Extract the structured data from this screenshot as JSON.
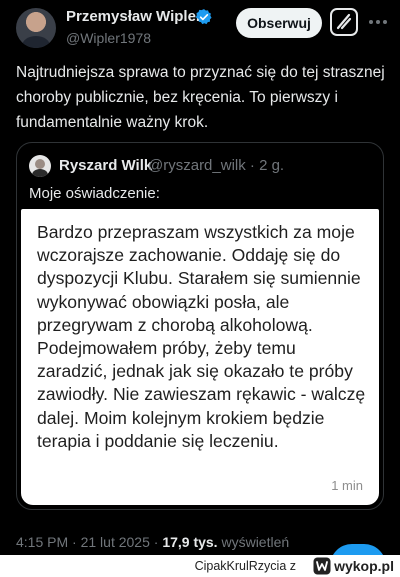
{
  "author": {
    "name": "Przemysław Wipler",
    "handle": "@Wipler1978"
  },
  "actions": {
    "follow_label": "Obserwuj"
  },
  "tweet": {
    "text": "Najtrudniejsza sprawa to przyznać się do tej strasznej choroby publicznie, bez kręcenia. To pierwszy i fundamentalnie ważny krok."
  },
  "quoted": {
    "name": "Ryszard Wilk",
    "handle_time": "@ryszard_wilk · 2 g.",
    "text": "Moje oświadczenie:",
    "message": "Bardzo przepraszam wszystkich za moje wczorajsze zachowanie. Oddaję się do dyspozycji Klubu. Starałem się sumiennie wykonywać obowiązki posła, ale przegrywam z chorobą alkoholową. Podejmowałem próby, żeby temu zaradzić, jednak jak się okazało te próby zawiodły. Nie zawieszam rękawic - walczę dalej. Moim kolejnym krokiem będzie terapia i poddanie się leczeniu.",
    "message_time": "1 min"
  },
  "meta": {
    "datetime": "4:15 PM · 21 lut 2025 · ",
    "views_count": "17,9 tys.",
    "views_label": " wyświetleń"
  },
  "watermark": {
    "user": "CipakKrulRzycia z",
    "site": "wykop.pl"
  },
  "colors": {
    "background": "#000000",
    "accent": "#1d9bf0",
    "verified": "#1d9bf0",
    "secondary_text": "#71767b"
  },
  "icons": {
    "verified": "verified-badge-icon",
    "grok": "grok-icon",
    "more": "more-options-icon",
    "wykop": "wykop-logo-icon"
  }
}
